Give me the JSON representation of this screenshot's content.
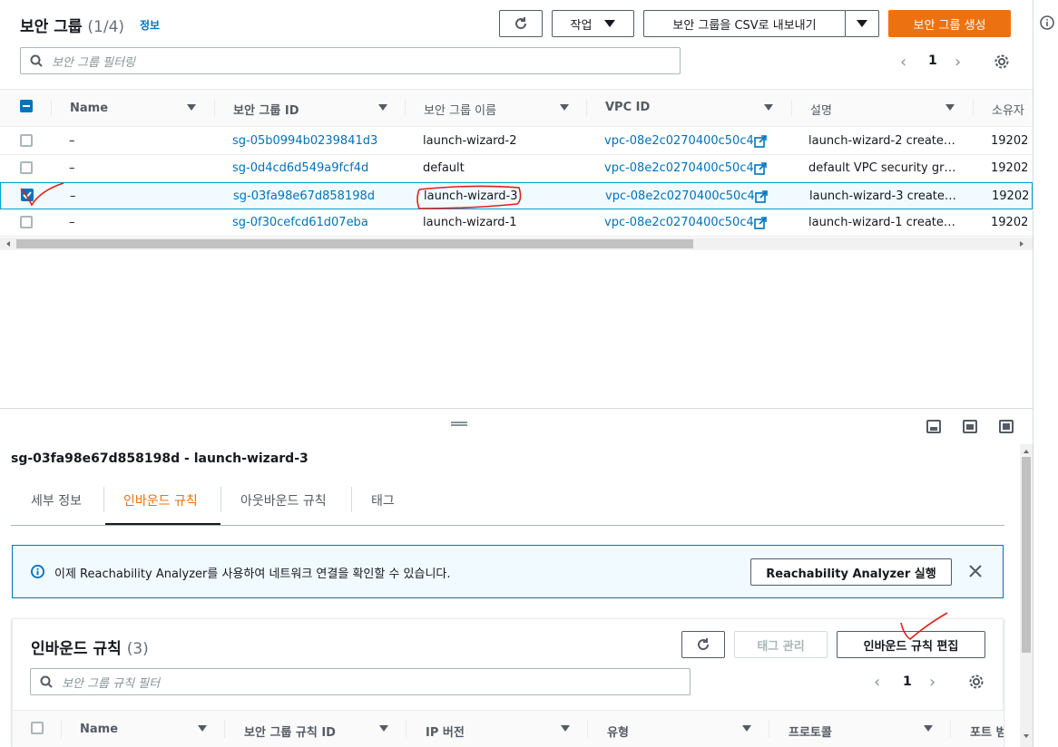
{
  "header": {
    "title": "보안 그룹",
    "count": "(1/4)",
    "info_link": "정보",
    "actions_label": "작업",
    "export_label": "보안 그룹을 CSV로 내보내기",
    "create_label": "보안 그룹 생성"
  },
  "filter": {
    "placeholder": "보안 그룹 필터링"
  },
  "pagination": {
    "page": "1"
  },
  "table": {
    "columns": [
      "Name",
      "보안 그룹 ID",
      "보안 그룹 이름",
      "VPC ID",
      "설명",
      "소유자"
    ],
    "rows": [
      {
        "name": "–",
        "id": "sg-05b0994b0239841d3",
        "group_name": "launch-wizard-2",
        "vpc": "vpc-08e2c0270400c50c4",
        "desc": "launch-wizard-2 create…",
        "owner": "19202",
        "selected": false
      },
      {
        "name": "–",
        "id": "sg-0d4cd6d549a9fcf4d",
        "group_name": "default",
        "vpc": "vpc-08e2c0270400c50c4",
        "desc": "default VPC security gr…",
        "owner": "19202",
        "selected": false
      },
      {
        "name": "–",
        "id": "sg-03fa98e67d858198d",
        "group_name": "launch-wizard-3",
        "vpc": "vpc-08e2c0270400c50c4",
        "desc": "launch-wizard-3 create…",
        "owner": "19202",
        "selected": true
      },
      {
        "name": "–",
        "id": "sg-0f30cefcd61d07eba",
        "group_name": "launch-wizard-1",
        "vpc": "vpc-08e2c0270400c50c4",
        "desc": "launch-wizard-1 create…",
        "owner": "19202",
        "selected": false
      }
    ]
  },
  "detail": {
    "title": "sg-03fa98e67d858198d - launch-wizard-3",
    "tabs": [
      "세부 정보",
      "인바운드 규칙",
      "아웃바운드 규칙",
      "태그"
    ],
    "active_tab": "인바운드 규칙",
    "alert_text": "이제 Reachability Analyzer를 사용하여 네트워크 연결을 확인할 수 있습니다.",
    "alert_button": "Reachability Analyzer 실행",
    "rules_title": "인바운드 규칙",
    "rules_count": "(3)",
    "manage_tags_label": "태그 관리",
    "edit_rules_label": "인바운드 규칙 편집",
    "rules_filter_placeholder": "보안 그룹 규칙 필터",
    "rules_page": "1",
    "rules_columns": [
      "Name",
      "보안 그룹 규칙 ID",
      "IP 버전",
      "유형",
      "프로토콜",
      "포트 범"
    ]
  },
  "colors": {
    "primary": "#ec7211",
    "link": "#0073bb",
    "annotation": "#e0201b",
    "alert_border": "#0073bb",
    "alert_bg": "#f1faff"
  }
}
